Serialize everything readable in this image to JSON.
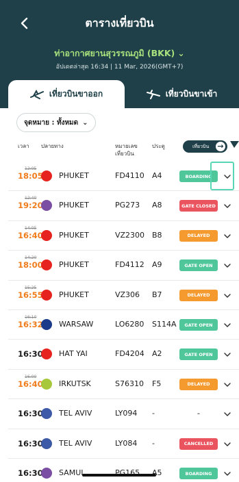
{
  "header": {
    "title": "ตารางเที่ยวบิน",
    "airport": "ท่าอากาศยานสุวรรณภูมิ (BKK)",
    "updated": "อัปเดตล่าสุด 16:34 | 11 Mar, 2026(GMT+7)"
  },
  "tabs": [
    {
      "label": "เที่ยวบินขาออก",
      "active": true,
      "icon": "plane-departure-icon"
    },
    {
      "label": "เที่ยวบินขาเข้า",
      "active": false,
      "icon": "plane-arrival-icon"
    }
  ],
  "filter": {
    "label": "จุดหมาย : ทั้งหมด"
  },
  "columns": {
    "time": "เวลา",
    "destination": "ปลายทาง",
    "flight_line1": "หมายเลข",
    "flight_line2": "เที่ยวบิน",
    "gate": "ประตู",
    "toggle": "เที่ยวบิน"
  },
  "colors": {
    "header_bg": "#1f4048",
    "accent_green": "#a7e07d",
    "late": "#f07c1c",
    "status_green": "#4fc79a",
    "status_red": "#e9545f",
    "status_orange": "#f59a2e"
  },
  "flights": [
    {
      "old_time": "12:05",
      "time": "18:05",
      "late": true,
      "airline_logo": "airasia-logo",
      "logo_color": "#e6231e",
      "destination": "PHUKET",
      "flight": "FD4110",
      "gate": "A4",
      "status": "BOARDING",
      "status_color": "green"
    },
    {
      "old_time": "12:40",
      "time": "19:20",
      "late": true,
      "airline_logo": "bangkok-airways-logo",
      "logo_color": "#7a4ea3",
      "destination": "PHUKET",
      "flight": "PG273",
      "gate": "A8",
      "status": "GATE CLOSED",
      "status_color": "red"
    },
    {
      "old_time": "14:05",
      "time": "16:40",
      "late": true,
      "airline_logo": "vietjet-logo",
      "logo_color": "#e6231e",
      "destination": "PHUKET",
      "flight": "VZ2300",
      "gate": "B8",
      "status": "DELAYED",
      "status_color": "orange"
    },
    {
      "old_time": "14:20",
      "time": "18:00",
      "late": true,
      "airline_logo": "airasia-logo",
      "logo_color": "#e6231e",
      "destination": "PHUKET",
      "flight": "FD4112",
      "gate": "A9",
      "status": "GATE OPEN",
      "status_color": "green"
    },
    {
      "old_time": "15:25",
      "time": "16:55",
      "late": true,
      "airline_logo": "vietjet-logo",
      "logo_color": "#e6231e",
      "destination": "PHUKET",
      "flight": "VZ306",
      "gate": "B7",
      "status": "DELAYED",
      "status_color": "orange"
    },
    {
      "old_time": "16:10",
      "time": "16:32",
      "late": true,
      "airline_logo": "lot-logo",
      "logo_color": "#1b3a8a",
      "destination": "WARSAW",
      "flight": "LO6280",
      "gate": "S114A",
      "status": "GATE OPEN",
      "status_color": "green"
    },
    {
      "old_time": "",
      "time": "16:30",
      "late": false,
      "airline_logo": "airasia-logo",
      "logo_color": "#e6231e",
      "destination": "HAT YAI",
      "flight": "FD4204",
      "gate": "A2",
      "status": "GATE OPEN",
      "status_color": "green"
    },
    {
      "old_time": "16:00",
      "time": "16:40",
      "late": true,
      "airline_logo": "s7-logo",
      "logo_color": "#a7c83a",
      "destination": "IRKUTSK",
      "flight": "S76310",
      "gate": "F5",
      "status": "DELAYED",
      "status_color": "orange"
    },
    {
      "old_time": "",
      "time": "16:30",
      "late": false,
      "airline_logo": "el-al-logo",
      "logo_color": "#3d5aa8",
      "destination": "TEL AVIV",
      "flight": "LY094",
      "gate": "-",
      "status": "-",
      "status_color": "none"
    },
    {
      "old_time": "",
      "time": "16:30",
      "late": false,
      "airline_logo": "el-al-logo",
      "logo_color": "#3d5aa8",
      "destination": "TEL AVIV",
      "flight": "LY084",
      "gate": "-",
      "status": "CANCELLED",
      "status_color": "red"
    },
    {
      "old_time": "",
      "time": "16:30",
      "late": false,
      "airline_logo": "bangkok-airways-logo",
      "logo_color": "#7a4ea3",
      "destination": "SAMUI",
      "flight": "PG165",
      "gate": "A5",
      "status": "BOARDING",
      "status_color": "green"
    }
  ]
}
